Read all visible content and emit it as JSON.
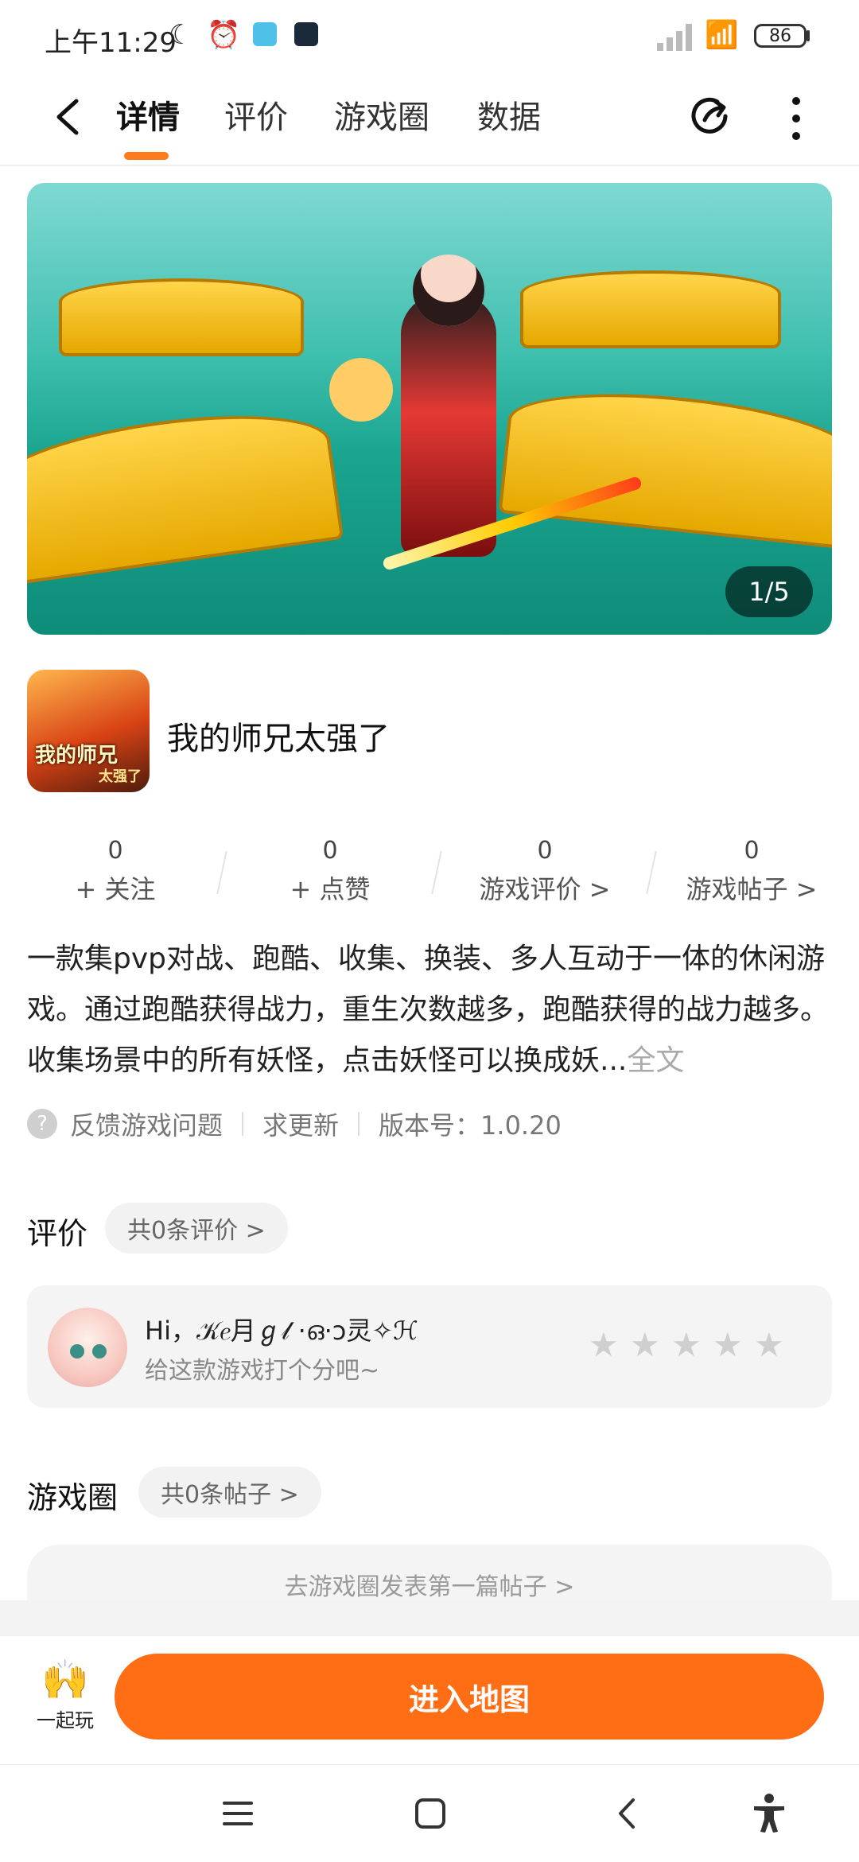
{
  "status_bar": {
    "time": "上午11:29",
    "battery": "86"
  },
  "nav": {
    "tabs": [
      "详情",
      "评价",
      "游戏圈",
      "数据"
    ]
  },
  "banner": {
    "page_indicator": "1/5"
  },
  "game": {
    "title": "我的师兄太强了",
    "icon_text": "我的师兄",
    "icon_subtext": "太强了"
  },
  "stats": [
    {
      "value": "0",
      "label": "+ 关注"
    },
    {
      "value": "0",
      "label": "+ 点赞"
    },
    {
      "value": "0",
      "label": "游戏评价 >"
    },
    {
      "value": "0",
      "label": "游戏帖子 >"
    }
  ],
  "description": {
    "text": "一款集pvp对战、跑酷、收集、换装、多人互动于一体的休闲游戏。通过跑酷获得战力，重生次数越多，跑酷获得的战力越多。收集场景中的所有妖怪，点击妖怪可以换成妖...",
    "more_label": "全文"
  },
  "meta": {
    "feedback": "反馈游戏问题",
    "request_update": "求更新",
    "version": "版本号：1.0.20"
  },
  "reviews": {
    "title": "评价",
    "count_pill": "共0条评价 >",
    "greeting": "Hi，𝒦𝑒月ℊ𝓁 ·ഒ·ↄ灵✧ℋ",
    "prompt": "给这款游戏打个分吧~",
    "stars": 0
  },
  "circle": {
    "title": "游戏圈",
    "count_pill": "共0条帖子 >",
    "cta": "去游戏圈发表第一篇帖子 >"
  },
  "action_bar": {
    "play_together": "一起玩",
    "enter_button": "进入地图"
  },
  "colors": {
    "accent": "#ff6d14"
  }
}
